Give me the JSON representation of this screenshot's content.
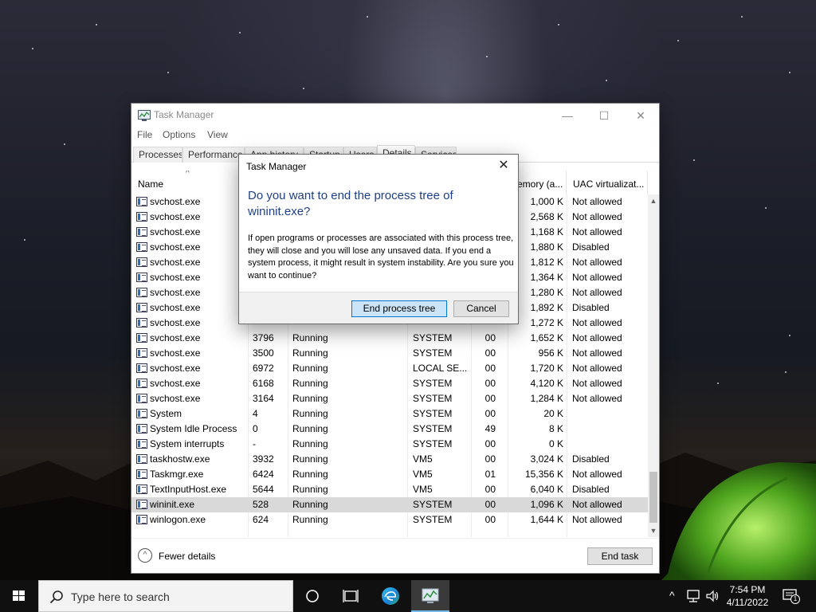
{
  "task_manager": {
    "title": "Task Manager",
    "window_buttons": {
      "minimize": "—",
      "maximize": "☐",
      "close": "✕"
    },
    "menu": [
      "File",
      "Options",
      "View"
    ],
    "tabs": [
      {
        "label": "Processes"
      },
      {
        "label": "Performance"
      },
      {
        "label": "App history"
      },
      {
        "label": "Startup"
      },
      {
        "label": "Users"
      },
      {
        "label": "Details",
        "active": true
      },
      {
        "label": "Services"
      }
    ],
    "columns": {
      "name": "Name",
      "memory": "emory (a...",
      "uac": "UAC virtualizat..."
    },
    "rows": [
      {
        "name": "svchost.exe",
        "pid": "",
        "status": "",
        "user": "",
        "cpu": "",
        "memory": "1,000 K",
        "uac": "Not allowed"
      },
      {
        "name": "svchost.exe",
        "pid": "",
        "status": "",
        "user": "",
        "cpu": "",
        "memory": "2,568 K",
        "uac": "Not allowed"
      },
      {
        "name": "svchost.exe",
        "pid": "",
        "status": "",
        "user": "",
        "cpu": "",
        "memory": "1,168 K",
        "uac": "Not allowed"
      },
      {
        "name": "svchost.exe",
        "pid": "",
        "status": "",
        "user": "",
        "cpu": "",
        "memory": "1,880 K",
        "uac": "Disabled"
      },
      {
        "name": "svchost.exe",
        "pid": "",
        "status": "",
        "user": "",
        "cpu": "",
        "memory": "1,812 K",
        "uac": "Not allowed"
      },
      {
        "name": "svchost.exe",
        "pid": "",
        "status": "",
        "user": "",
        "cpu": "",
        "memory": "1,364 K",
        "uac": "Not allowed"
      },
      {
        "name": "svchost.exe",
        "pid": "",
        "status": "",
        "user": "",
        "cpu": "",
        "memory": "1,280 K",
        "uac": "Not allowed"
      },
      {
        "name": "svchost.exe",
        "pid": "",
        "status": "",
        "user": "",
        "cpu": "",
        "memory": "1,892 K",
        "uac": "Disabled"
      },
      {
        "name": "svchost.exe",
        "pid": "",
        "status": "",
        "user": "",
        "cpu": "",
        "memory": "1,272 K",
        "uac": "Not allowed"
      },
      {
        "name": "svchost.exe",
        "pid": "3796",
        "status": "Running",
        "user": "SYSTEM",
        "cpu": "00",
        "memory": "1,652 K",
        "uac": "Not allowed"
      },
      {
        "name": "svchost.exe",
        "pid": "3500",
        "status": "Running",
        "user": "SYSTEM",
        "cpu": "00",
        "memory": "956 K",
        "uac": "Not allowed"
      },
      {
        "name": "svchost.exe",
        "pid": "6972",
        "status": "Running",
        "user": "LOCAL SE...",
        "cpu": "00",
        "memory": "1,720 K",
        "uac": "Not allowed"
      },
      {
        "name": "svchost.exe",
        "pid": "6168",
        "status": "Running",
        "user": "SYSTEM",
        "cpu": "00",
        "memory": "4,120 K",
        "uac": "Not allowed"
      },
      {
        "name": "svchost.exe",
        "pid": "3164",
        "status": "Running",
        "user": "SYSTEM",
        "cpu": "00",
        "memory": "1,284 K",
        "uac": "Not allowed"
      },
      {
        "name": "System",
        "pid": "4",
        "status": "Running",
        "user": "SYSTEM",
        "cpu": "00",
        "memory": "20 K",
        "uac": ""
      },
      {
        "name": "System Idle Process",
        "pid": "0",
        "status": "Running",
        "user": "SYSTEM",
        "cpu": "49",
        "memory": "8 K",
        "uac": ""
      },
      {
        "name": "System interrupts",
        "pid": "-",
        "status": "Running",
        "user": "SYSTEM",
        "cpu": "00",
        "memory": "0 K",
        "uac": ""
      },
      {
        "name": "taskhostw.exe",
        "pid": "3932",
        "status": "Running",
        "user": "VM5",
        "cpu": "00",
        "memory": "3,024 K",
        "uac": "Disabled"
      },
      {
        "name": "Taskmgr.exe",
        "pid": "6424",
        "status": "Running",
        "user": "VM5",
        "cpu": "01",
        "memory": "15,356 K",
        "uac": "Not allowed"
      },
      {
        "name": "TextInputHost.exe",
        "pid": "5644",
        "status": "Running",
        "user": "VM5",
        "cpu": "00",
        "memory": "6,040 K",
        "uac": "Disabled"
      },
      {
        "name": "wininit.exe",
        "pid": "528",
        "status": "Running",
        "user": "SYSTEM",
        "cpu": "00",
        "memory": "1,096 K",
        "uac": "Not allowed",
        "selected": true
      },
      {
        "name": "winlogon.exe",
        "pid": "624",
        "status": "Running",
        "user": "SYSTEM",
        "cpu": "00",
        "memory": "1,644 K",
        "uac": "Not allowed"
      }
    ],
    "footer": {
      "fewer_details": "Fewer details",
      "end_task": "End task"
    }
  },
  "dialog": {
    "title": "Task Manager",
    "close": "✕",
    "heading": "Do you want to end the process tree of wininit.exe?",
    "body": "If open programs or processes are associated with this process tree, they will close and you will lose any unsaved data. If you end a system process, it might result in system instability. Are you sure you want to continue?",
    "primary_button": "End process tree",
    "secondary_button": "Cancel"
  },
  "taskbar": {
    "search_placeholder": "Type here to search",
    "tray": {
      "chevron": "^",
      "time": "7:54 PM",
      "date": "4/11/2022",
      "notification_count": "1"
    }
  },
  "colors": {
    "dialog_heading": "#1e3f8a",
    "primary_button_bg": "#cce4f7",
    "primary_button_border": "#0078d7",
    "selected_row": "#d9d9d9",
    "taskbar_bg": "#101010"
  }
}
